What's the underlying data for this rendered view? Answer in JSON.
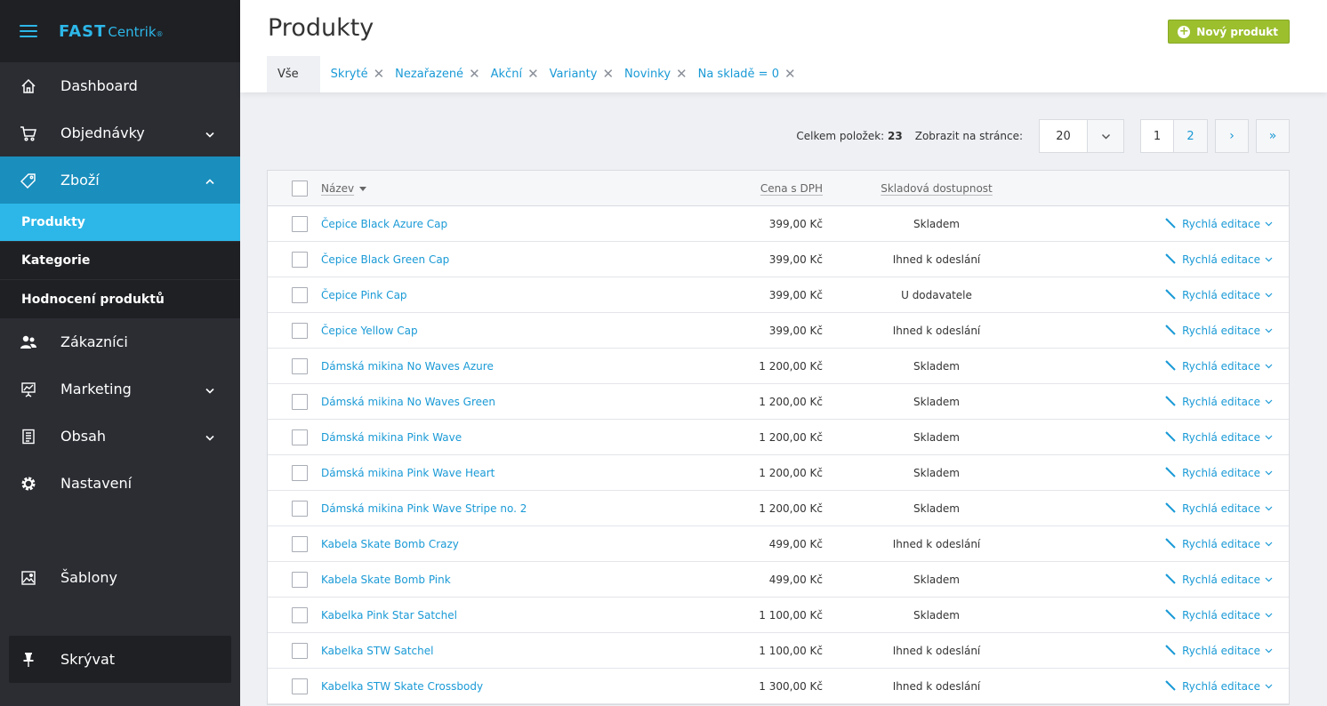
{
  "app": {
    "logo_bold": "FAST",
    "logo_light": "Centrik",
    "logo_reg": "®"
  },
  "sidebar": {
    "items": [
      {
        "label": "Dashboard"
      },
      {
        "label": "Objednávky"
      },
      {
        "label": "Zboží"
      },
      {
        "label": "Zákazníci"
      },
      {
        "label": "Marketing"
      },
      {
        "label": "Obsah"
      },
      {
        "label": "Nastavení"
      },
      {
        "label": "Šablony"
      }
    ],
    "subitems": [
      {
        "label": "Produkty"
      },
      {
        "label": "Kategorie"
      },
      {
        "label": "Hodnocení produktů"
      }
    ],
    "pin_label": "Skrývat"
  },
  "header": {
    "title": "Produkty",
    "new_button": "Nový produkt",
    "tabs": [
      {
        "label": "Vše"
      },
      {
        "label": "Skryté"
      },
      {
        "label": "Nezařazené"
      },
      {
        "label": "Akční"
      },
      {
        "label": "Varianty"
      },
      {
        "label": "Novinky"
      },
      {
        "label": "Na skladě = 0"
      }
    ]
  },
  "pager": {
    "total_label": "Celkem položek:",
    "total_value": "23",
    "per_page_label": "Zobrazit na stránce:",
    "per_page_value": "20",
    "pages": [
      "1",
      "2"
    ],
    "next": "›",
    "last": "»"
  },
  "table": {
    "columns": {
      "name": "Název",
      "price": "Cena s DPH",
      "stock": "Skladová dostupnost"
    },
    "action_label": "Rychlá editace",
    "rows": [
      {
        "name": "Čepice Black Azure Cap",
        "price": "399,00 Kč",
        "stock": "Skladem"
      },
      {
        "name": "Čepice Black Green Cap",
        "price": "399,00 Kč",
        "stock": "Ihned k odeslání"
      },
      {
        "name": "Čepice Pink Cap",
        "price": "399,00 Kč",
        "stock": "U dodavatele"
      },
      {
        "name": "Čepice Yellow Cap",
        "price": "399,00 Kč",
        "stock": "Ihned k odeslání"
      },
      {
        "name": "Dámská mikina No Waves Azure",
        "price": "1 200,00 Kč",
        "stock": "Skladem"
      },
      {
        "name": "Dámská mikina No Waves Green",
        "price": "1 200,00 Kč",
        "stock": "Skladem"
      },
      {
        "name": "Dámská mikina Pink Wave",
        "price": "1 200,00 Kč",
        "stock": "Skladem"
      },
      {
        "name": "Dámská mikina Pink Wave Heart",
        "price": "1 200,00 Kč",
        "stock": "Skladem"
      },
      {
        "name": "Dámská mikina Pink Wave Stripe no. 2",
        "price": "1 200,00 Kč",
        "stock": "Skladem"
      },
      {
        "name": "Kabela Skate Bomb Crazy",
        "price": "499,00 Kč",
        "stock": "Ihned k odeslání"
      },
      {
        "name": "Kabela Skate Bomb Pink",
        "price": "499,00 Kč",
        "stock": "Skladem"
      },
      {
        "name": "Kabelka Pink Star Satchel",
        "price": "1 100,00 Kč",
        "stock": "Skladem"
      },
      {
        "name": "Kabelka STW Satchel",
        "price": "1 100,00 Kč",
        "stock": "Ihned k odeslání"
      },
      {
        "name": "Kabelka STW Skate Crossbody",
        "price": "1 300,00 Kč",
        "stock": "Ihned k odeslání"
      }
    ]
  },
  "colors": {
    "accent": "#2db7e8",
    "active_nav": "#1a8ebd",
    "link": "#1a9ad6",
    "success_button": "#9cbf2e",
    "sidebar_bg": "#2b2d33"
  }
}
